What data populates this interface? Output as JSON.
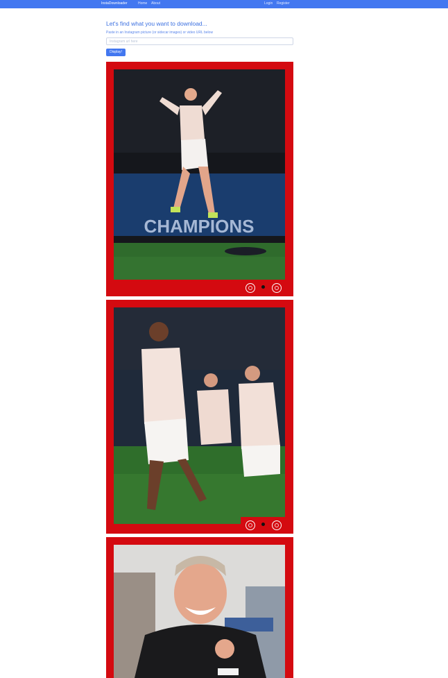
{
  "navbar": {
    "brand": "InstaDownloader",
    "links": [
      "Home",
      "About"
    ],
    "auth": [
      "Login",
      "Register"
    ]
  },
  "form": {
    "heading": "Let's find what you want to download...",
    "subtext": "Paste in an Instagram picture (or sidecar images) or video URL below",
    "url_placeholder": "Instagram url here",
    "url_value": "",
    "submit_label": "Display!"
  },
  "colors": {
    "accent": "#4277f0",
    "frame_red": "#d40a10"
  },
  "results": [
    {
      "kind": "image",
      "subject": "player-jumping-celebration"
    },
    {
      "kind": "image",
      "subject": "players-running-celebration"
    },
    {
      "kind": "image",
      "subject": "manager-smiling"
    }
  ]
}
